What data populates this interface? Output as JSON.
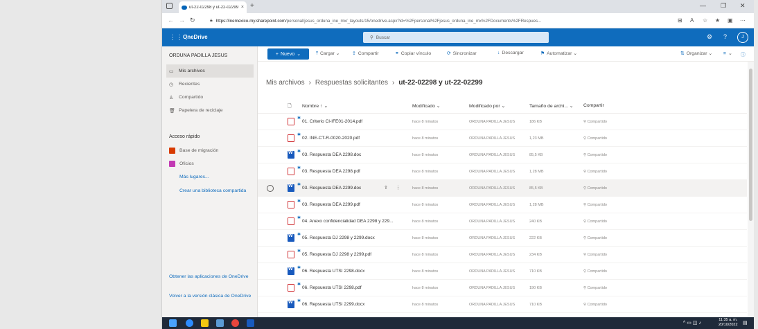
{
  "browser": {
    "tab_title": "ut-22-02298 y ut-22-02299 - On",
    "tab_close": "×",
    "new_tab": "+",
    "url_host": "https://inemexico-my.sharepoint.com",
    "url_path": "/personal/jesus_orduna_ine_mx/_layouts/15/onedrive.aspx?id=%2Fpersonal%2Fjesus_orduna_ine_mx%2FDocuments%2FRespues..."
  },
  "header": {
    "app_name": "OneDrive",
    "search_placeholder": "Buscar",
    "avatar_initial": "J"
  },
  "sidebar": {
    "owner": "ORDUNA PADILLA JESUS",
    "items": [
      {
        "label": "Mis archivos"
      },
      {
        "label": "Recientes"
      },
      {
        "label": "Compartido"
      },
      {
        "label": "Papelera de reciclaje"
      }
    ],
    "quick_access_title": "Acceso rápido",
    "quick_access": [
      {
        "label": "Base de migración",
        "color": "#d83b01"
      },
      {
        "label": "Oficios",
        "color": "#c239b3"
      }
    ],
    "more_places": "Más lugares...",
    "create_library": "Crear una biblioteca compartida",
    "get_apps": "Obtener las aplicaciones de OneDrive",
    "classic_view": "Volver a la versión clásica de OneDrive"
  },
  "commands": {
    "new": "Nuevo",
    "upload": "Cargar",
    "share": "Compartir",
    "copy_link": "Copiar vínculo",
    "sync": "Sincronizar",
    "download": "Descargar",
    "automate": "Automatizar",
    "organize": "Organizar"
  },
  "breadcrumb": {
    "root": "Mis archivos",
    "parent": "Respuestas solicitantes",
    "current": "ut-22-02298 y ut-22-02299"
  },
  "columns": {
    "name": "Nombre ↑ ⌄",
    "modified": "Modificado ⌄",
    "modified_by": "Modificado por ⌄",
    "size": "Tamaño de archi... ⌄",
    "sharing": "Compartir"
  },
  "files": [
    {
      "name": "01. Criterio CI-IFE01-2014.pdf",
      "type": "pdf",
      "modified": "hace 8 minutos",
      "by": "ORDUNA PADILLA JESUS",
      "size": "186 KB",
      "sharing": "Compartido"
    },
    {
      "name": "02. INE-CT-R-0020-2020.pdf",
      "type": "pdf",
      "modified": "hace 8 minutos",
      "by": "ORDUNA PADILLA JESUS",
      "size": "1,23 MB",
      "sharing": "Compartido"
    },
    {
      "name": "03. Respuesta DEA 2298.doc",
      "type": "doc",
      "modified": "hace 8 minutos",
      "by": "ORDUNA PADILLA JESUS",
      "size": "85,5 KB",
      "sharing": "Compartido"
    },
    {
      "name": "03. Respuesta DEA 2298.pdf",
      "type": "pdf",
      "modified": "hace 8 minutos",
      "by": "ORDUNA PADILLA JESUS",
      "size": "1,28 MB",
      "sharing": "Compartido"
    },
    {
      "name": "03. Respuesta DEA 2299.doc",
      "type": "doc",
      "modified": "hace 8 minutos",
      "by": "ORDUNA PADILLA JESUS",
      "size": "85,5 KB",
      "sharing": "Compartido"
    },
    {
      "name": "03. Respuesta DEA 2299.pdf",
      "type": "pdf",
      "modified": "hace 8 minutos",
      "by": "ORDUNA PADILLA JESUS",
      "size": "1,28 MB",
      "sharing": "Compartido"
    },
    {
      "name": "04. Anexo confidencialidad DEA 2298 y 229...",
      "type": "pdf",
      "modified": "hace 8 minutos",
      "by": "ORDUNA PADILLA JESUS",
      "size": "240 KB",
      "sharing": "Compartido"
    },
    {
      "name": "05. Respuesta DJ 2298 y 2299.docx",
      "type": "doc",
      "modified": "hace 8 minutos",
      "by": "ORDUNA PADILLA JESUS",
      "size": "222 KB",
      "sharing": "Compartido"
    },
    {
      "name": "05. Respuesta DJ 2298 y 2299.pdf",
      "type": "pdf",
      "modified": "hace 8 minutos",
      "by": "ORDUNA PADILLA JESUS",
      "size": "234 KB",
      "sharing": "Compartido"
    },
    {
      "name": "06. Respuesta UTSI 2298.docx",
      "type": "doc",
      "modified": "hace 8 minutos",
      "by": "ORDUNA PADILLA JESUS",
      "size": "710 KB",
      "sharing": "Compartido"
    },
    {
      "name": "06. Repsuesta UTSI 2298.pdf",
      "type": "pdf",
      "modified": "hace 8 minutos",
      "by": "ORDUNA PADILLA JESUS",
      "size": "190 KB",
      "sharing": "Compartido"
    },
    {
      "name": "06. Repsuesta UTSI 2299.docx",
      "type": "doc",
      "modified": "hace 8 minutos",
      "by": "ORDUNA PADILLA JESUS",
      "size": "710 KB",
      "sharing": "Compartido"
    }
  ],
  "taskbar": {
    "time": "11:35 a. m.",
    "date": "20/10/2022"
  },
  "colors": {
    "brand": "#0f6cbd",
    "pdf": "#d13438",
    "word": "#185abd"
  }
}
